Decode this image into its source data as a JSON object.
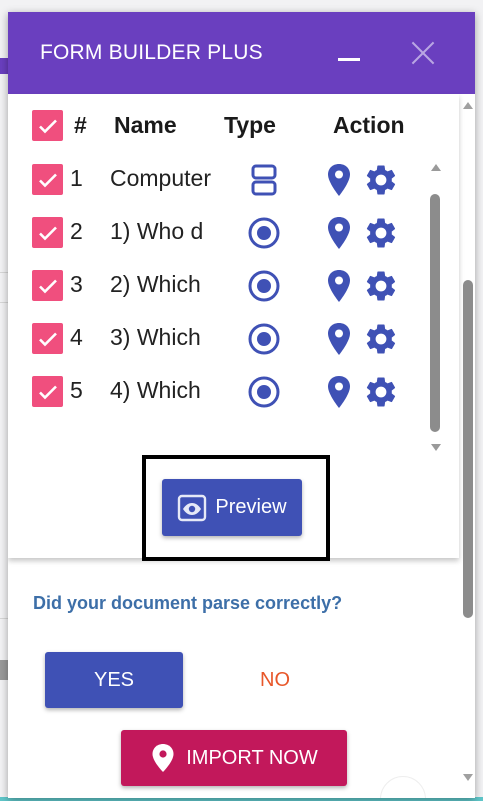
{
  "header": {
    "title": "FORM BUILDER PLUS",
    "minimize_icon": "minimize-icon",
    "close_icon": "close-icon"
  },
  "table": {
    "columns": {
      "hash": "#",
      "name": "Name",
      "type": "Type",
      "action": "Action"
    },
    "rows": [
      {
        "num": "1",
        "name": "Computer",
        "type_icon": "section-icon",
        "checked": true
      },
      {
        "num": "2",
        "name": "1) Who d",
        "type_icon": "radio-icon",
        "checked": true
      },
      {
        "num": "3",
        "name": "2) Which",
        "type_icon": "radio-icon",
        "checked": true
      },
      {
        "num": "4",
        "name": "3) Which",
        "type_icon": "radio-icon",
        "checked": true
      },
      {
        "num": "5",
        "name": "4) Which",
        "type_icon": "radio-icon",
        "checked": true
      }
    ]
  },
  "preview": {
    "label": "Preview",
    "icon": "eye-icon"
  },
  "parse": {
    "question": "Did your document parse correctly?",
    "yes_label": "YES",
    "no_label": "NO"
  },
  "import": {
    "label": "IMPORT NOW",
    "icon": "map-pin-icon"
  },
  "colors": {
    "header": "#6a3fbf",
    "checkbox": "#f04f7e",
    "primary": "#3f51b5",
    "import": "#c2185b",
    "no": "#e8572a",
    "question": "#3d6fa8"
  }
}
